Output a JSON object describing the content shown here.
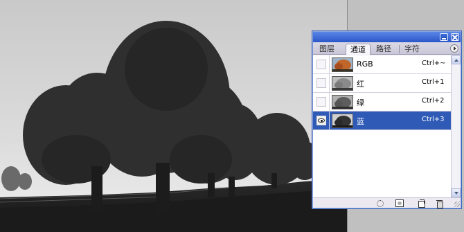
{
  "canvas": {
    "image_subject": "black-and-white photo of trees in a field",
    "fill_color": "#d6d6d6"
  },
  "panel": {
    "tabs": [
      {
        "label": "图层",
        "active": false
      },
      {
        "label": "通道",
        "active": true
      },
      {
        "label": "路径",
        "active": false
      },
      {
        "label": "字符",
        "active": false
      }
    ],
    "channels": [
      {
        "name": "RGB",
        "shortcut": "Ctrl+~",
        "visible": false,
        "selected": false,
        "thumb": "color"
      },
      {
        "name": "红",
        "shortcut": "Ctrl+1",
        "visible": false,
        "selected": false,
        "thumb": "gray-light"
      },
      {
        "name": "绿",
        "shortcut": "Ctrl+2",
        "visible": false,
        "selected": false,
        "thumb": "gray-mid"
      },
      {
        "name": "蓝",
        "shortcut": "Ctrl+3",
        "visible": true,
        "selected": true,
        "thumb": "gray-dark"
      }
    ],
    "footer_icons": [
      "load-selection-icon",
      "save-selection-icon",
      "new-channel-icon",
      "delete-channel-icon"
    ],
    "selected_color": "#2f5bb7",
    "titlebar_color": "#2b56c8"
  }
}
